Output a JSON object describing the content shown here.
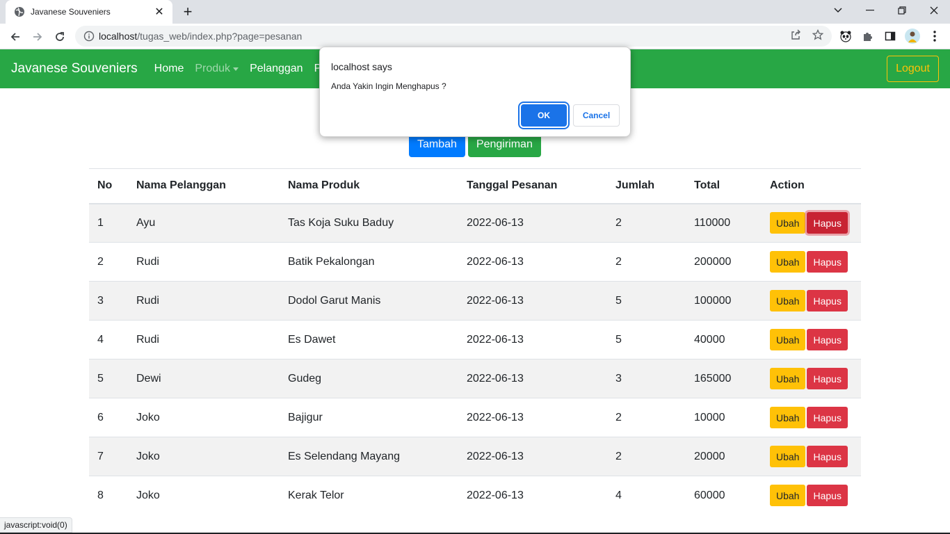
{
  "browser": {
    "tab_title": "Javanese Souveniers",
    "url_host": "localhost",
    "url_path": "/tugas_web/index.php?page=pesanan"
  },
  "navbar": {
    "brand": "Javanese Souveniers",
    "links": [
      "Home",
      "Produk",
      "Pelanggan",
      "Pe"
    ],
    "logout": "Logout"
  },
  "actions": {
    "add": "Tambah",
    "shipping": "Pengiriman"
  },
  "table": {
    "headers": [
      "No",
      "Nama Pelanggan",
      "Nama Produk",
      "Tanggal Pesanan",
      "Jumlah",
      "Total",
      "Action"
    ],
    "rows": [
      {
        "no": "1",
        "customer": "Ayu",
        "product": "Tas Koja Suku Baduy",
        "date": "2022-06-13",
        "qty": "2",
        "total": "110000"
      },
      {
        "no": "2",
        "customer": "Rudi",
        "product": "Batik Pekalongan",
        "date": "2022-06-13",
        "qty": "2",
        "total": "200000"
      },
      {
        "no": "3",
        "customer": "Rudi",
        "product": "Dodol Garut Manis",
        "date": "2022-06-13",
        "qty": "5",
        "total": "100000"
      },
      {
        "no": "4",
        "customer": "Rudi",
        "product": "Es Dawet",
        "date": "2022-06-13",
        "qty": "5",
        "total": "40000"
      },
      {
        "no": "5",
        "customer": "Dewi",
        "product": "Gudeg",
        "date": "2022-06-13",
        "qty": "3",
        "total": "165000"
      },
      {
        "no": "6",
        "customer": "Joko",
        "product": "Bajigur",
        "date": "2022-06-13",
        "qty": "2",
        "total": "10000"
      },
      {
        "no": "7",
        "customer": "Joko",
        "product": "Es Selendang Mayang",
        "date": "2022-06-13",
        "qty": "2",
        "total": "20000"
      },
      {
        "no": "8",
        "customer": "Joko",
        "product": "Kerak Telor",
        "date": "2022-06-13",
        "qty": "4",
        "total": "60000"
      }
    ],
    "edit_label": "Ubah",
    "delete_label": "Hapus"
  },
  "dialog": {
    "title": "localhost says",
    "message": "Anda Yakin Ingin Menghapus ?",
    "ok": "OK",
    "cancel": "Cancel"
  },
  "status_bar": "javascript:void(0)"
}
